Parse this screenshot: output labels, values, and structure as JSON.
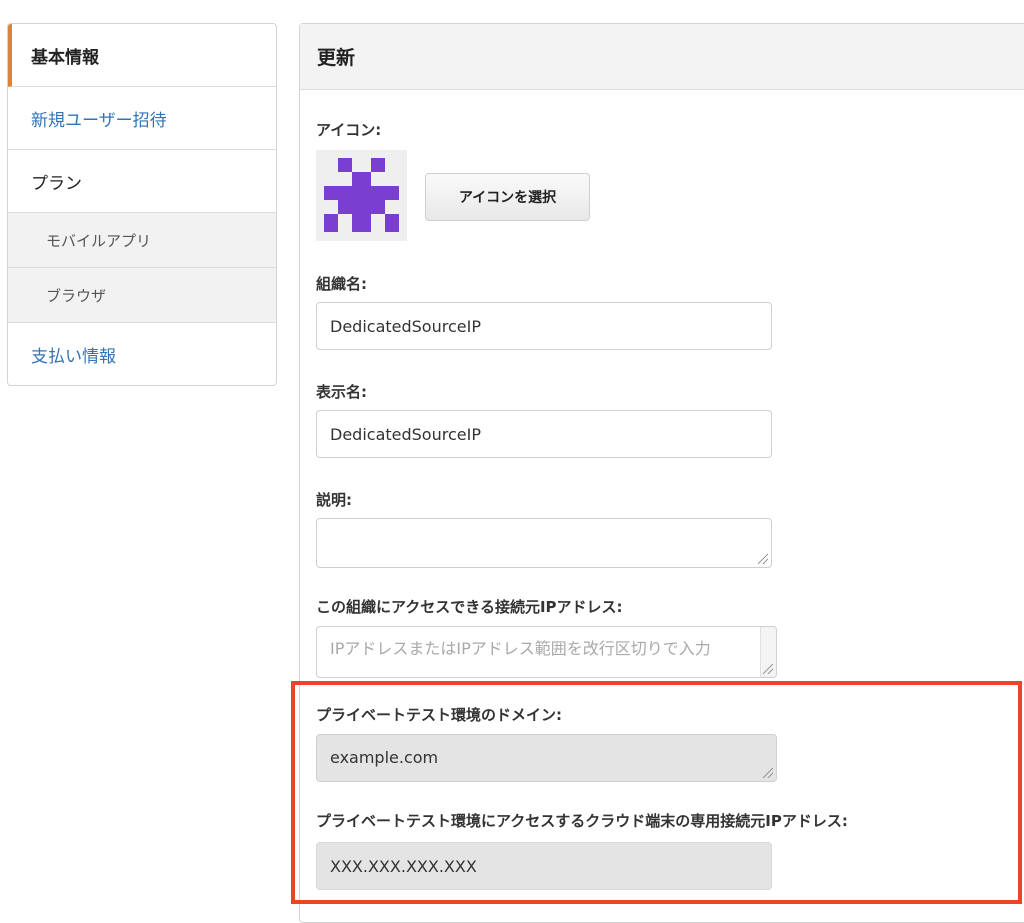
{
  "sidebar": {
    "items": [
      {
        "label": "基本情報"
      },
      {
        "label": "新規ユーザー招待"
      },
      {
        "label": "プラン"
      },
      {
        "label": "モバイルアプリ"
      },
      {
        "label": "ブラウザ"
      },
      {
        "label": "支払い情報"
      }
    ]
  },
  "panel": {
    "title": "更新",
    "icon_label": "アイコン:",
    "select_icon_button": "アイコンを選択",
    "org_name_label": "組織名:",
    "org_name_value": "DedicatedSourceIP",
    "display_name_label": "表示名:",
    "display_name_value": "DedicatedSourceIP",
    "description_label": "説明:",
    "description_value": "",
    "ip_label": "この組織にアクセスできる接続元IPアドレス:",
    "ip_placeholder": "IPアドレスまたはIPアドレス範囲を改行区切りで入力",
    "private_domain_label": "プライベートテスト環境のドメイン:",
    "private_domain_value": "example.com",
    "private_ip_label": "プライベートテスト環境にアクセスするクラウド端末の専用接続元IPアドレス:",
    "private_ip_value": "XXX.XXX.XXX.XXX"
  },
  "colors": {
    "accent": "#d9843a",
    "link": "#3374b7",
    "highlight": "#e8452a",
    "icon_purple": "#7a3fd0"
  }
}
